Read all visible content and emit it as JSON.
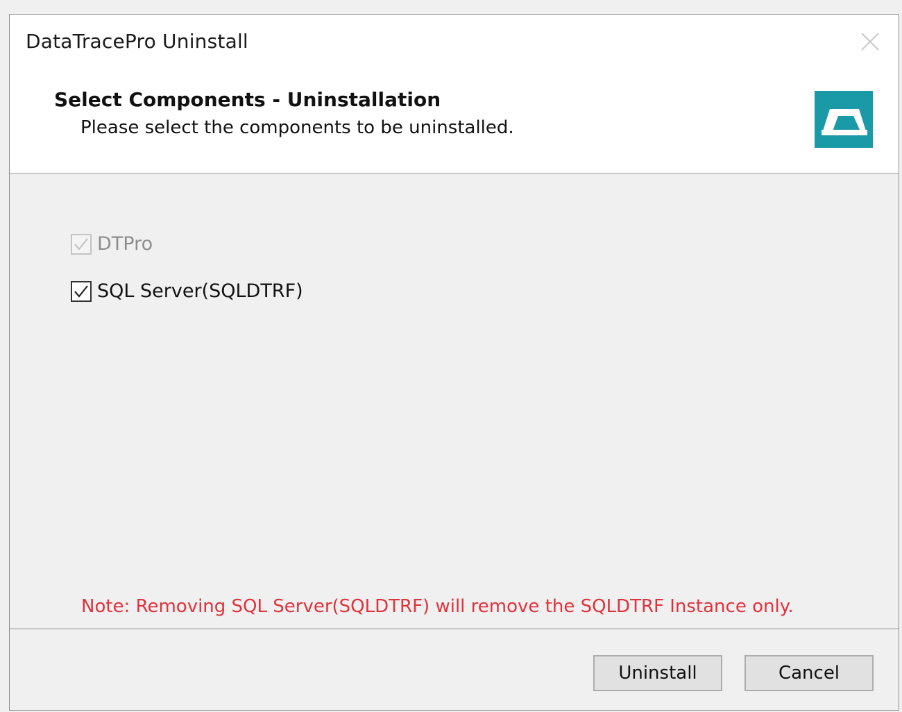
{
  "window": {
    "title": "DataTracePro Uninstall"
  },
  "header": {
    "title": "Select Components - Uninstallation",
    "subtitle": "Please select the components to be uninstalled.",
    "logo_icon": "datatrace-logo-icon"
  },
  "components": [
    {
      "label": "DTPro",
      "checked": true,
      "disabled": true
    },
    {
      "label": "SQL Server(SQLDTRF)",
      "checked": true,
      "disabled": false
    }
  ],
  "note": "Note: Removing SQL Server(SQLDTRF) will remove the SQLDTRF Instance only.",
  "buttons": {
    "uninstall": "Uninstall",
    "cancel": "Cancel"
  },
  "colors": {
    "note": "#e0323c",
    "logo": "#1a9aa6"
  }
}
